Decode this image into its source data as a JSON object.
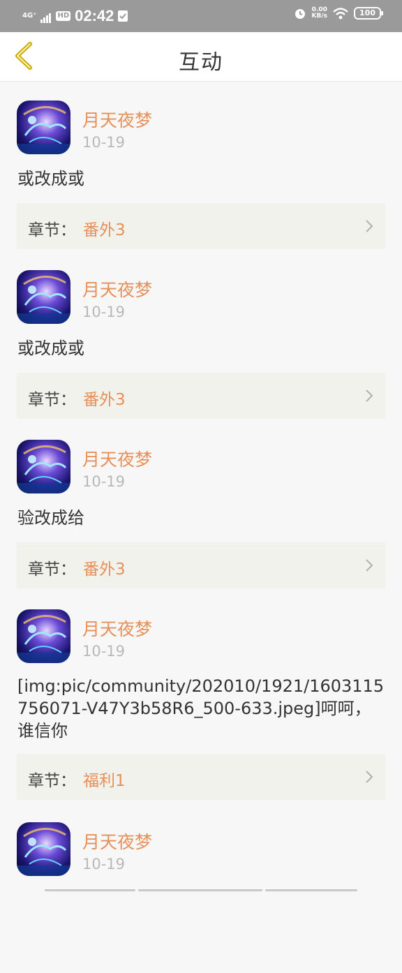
{
  "status_bar": {
    "signal": "4G⁺",
    "hd": "HD",
    "time": "02:42",
    "net_speed_value": "0.00",
    "net_speed_unit": "KB/s",
    "battery": "100"
  },
  "header": {
    "title": "互动",
    "back_icon": "chevron-left-icon"
  },
  "colors": {
    "accent": "#e69059",
    "back_icon": "#c9a800",
    "chapter_bg": "#f2f2ec"
  },
  "feed": {
    "items": [
      {
        "user": "月天夜梦",
        "date": "10-19",
        "content": "或改成或",
        "chapter_label": "章节：",
        "chapter_name": "番外3"
      },
      {
        "user": "月天夜梦",
        "date": "10-19",
        "content": "或改成或",
        "chapter_label": "章节：",
        "chapter_name": "番外3"
      },
      {
        "user": "月天夜梦",
        "date": "10-19",
        "content": "验改成给",
        "chapter_label": "章节：",
        "chapter_name": "番外3"
      },
      {
        "user": "月天夜梦",
        "date": "10-19",
        "content": "[img:pic/community/202010/1921/1603115756071-V47Y3b58R6_500-633.jpeg]呵呵，谁信你",
        "chapter_label": "章节：",
        "chapter_name": "福利1"
      },
      {
        "user": "月天夜梦",
        "date": "10-19"
      }
    ]
  }
}
